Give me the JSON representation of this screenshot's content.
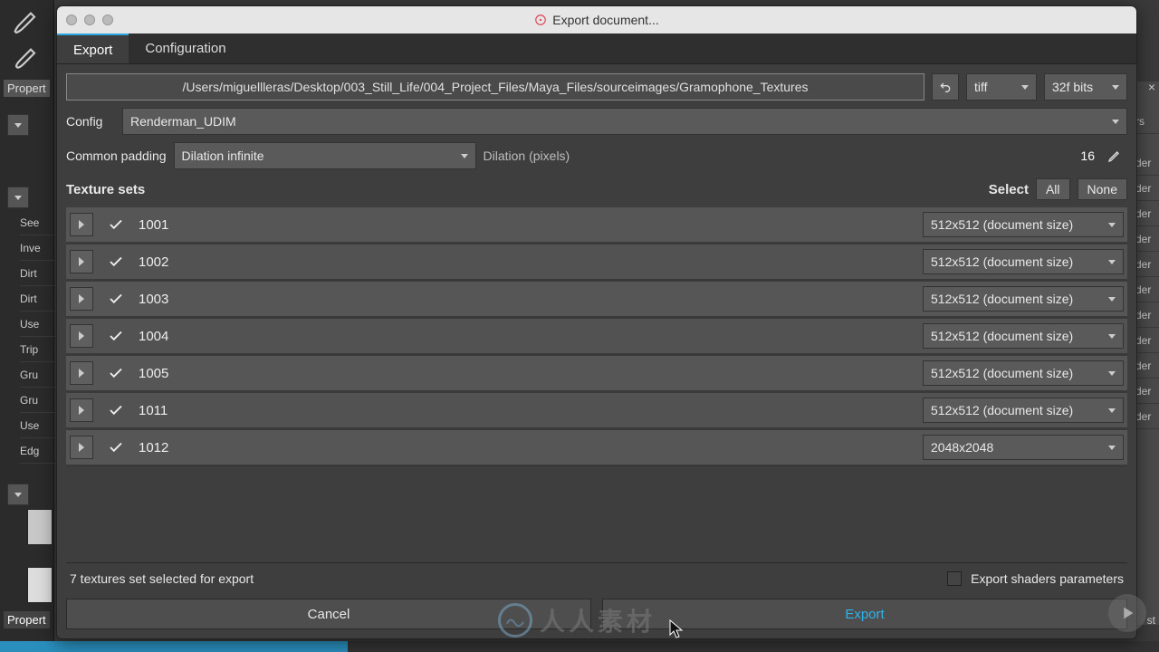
{
  "window": {
    "title": "Export document..."
  },
  "tabs": {
    "export": "Export",
    "configuration": "Configuration"
  },
  "path": "/Users/miguellleras/Desktop/003_Still_Life/004_Project_Files/Maya_Files/sourceimages/Gramophone_Textures",
  "format": "tiff",
  "depth": "32f bits",
  "config_label": "Config",
  "config_value": "Renderman_UDIM",
  "padding_label": "Common padding",
  "padding_value": "Dilation infinite",
  "dilation_label": "Dilation (pixels)",
  "dilation_value": "16",
  "sets_header": "Texture sets",
  "select_label": "Select",
  "all_label": "All",
  "none_label": "None",
  "texture_sets": [
    {
      "name": "1001",
      "size": "512x512 (document size)"
    },
    {
      "name": "1002",
      "size": "512x512 (document size)"
    },
    {
      "name": "1003",
      "size": "512x512 (document size)"
    },
    {
      "name": "1004",
      "size": "512x512 (document size)"
    },
    {
      "name": "1005",
      "size": "512x512 (document size)"
    },
    {
      "name": "1011",
      "size": "512x512 (document size)"
    },
    {
      "name": "1012",
      "size": "2048x2048"
    }
  ],
  "status": "7 textures set selected for export",
  "export_shaders_label": "Export shaders parameters",
  "cancel_label": "Cancel",
  "export_label": "Export",
  "bg": {
    "properties": "Propert",
    "properties2": "Propert",
    "left_items": [
      "See",
      "Inve",
      "Dirt",
      "Dirt",
      "Use",
      "Trip",
      "Gru",
      "Gru",
      "Use",
      "Edg"
    ],
    "right_items": [
      "rs",
      "der",
      "der",
      "der",
      "der",
      "der",
      "der",
      "der",
      "der",
      "der",
      "der",
      "der"
    ],
    "right_last": "st"
  },
  "watermark": "人人素材"
}
